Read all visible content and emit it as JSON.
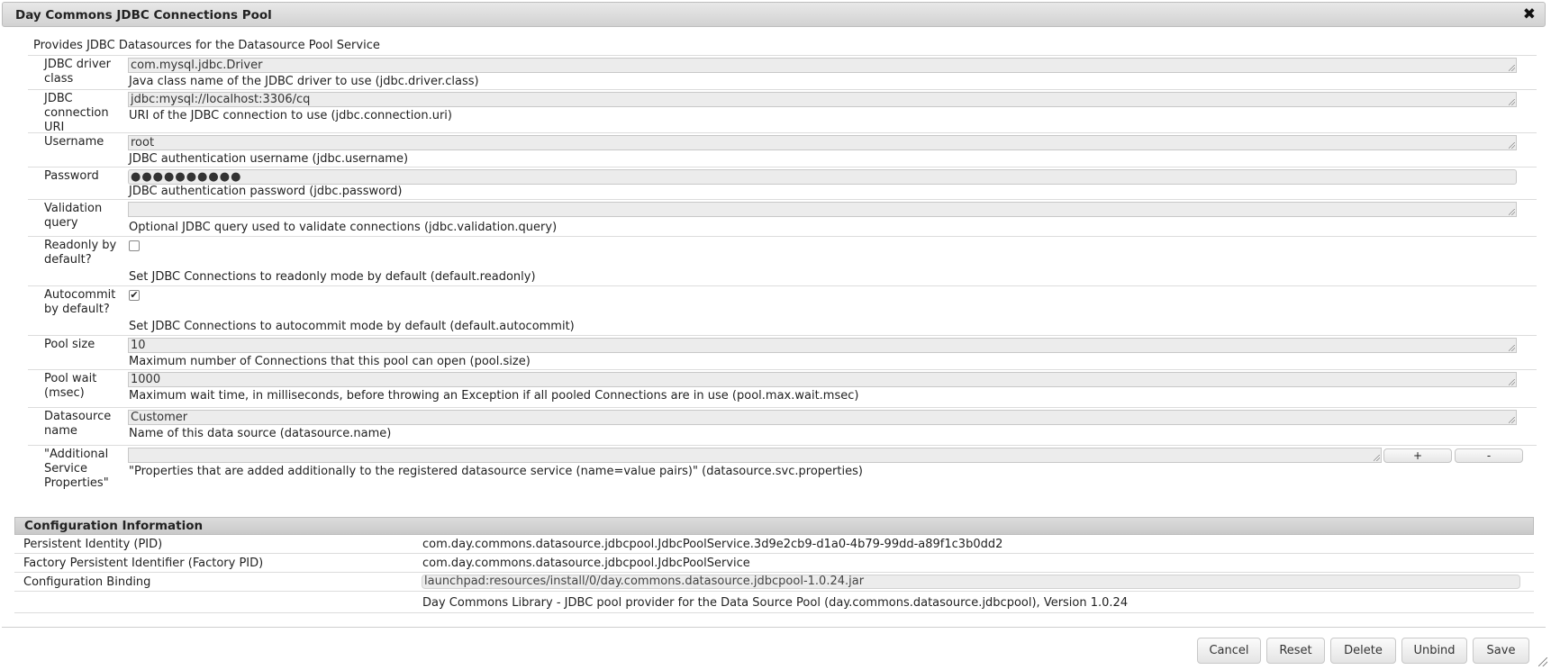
{
  "dialog": {
    "title": "Day Commons JDBC Connections Pool",
    "close_glyph": "✖",
    "description": "Provides JDBC Datasources for the Datasource Pool Service"
  },
  "fields": [
    {
      "label": "JDBC driver class",
      "value": "com.mysql.jdbc.Driver",
      "help": "Java class name of the JDBC driver to use (jdbc.driver.class)"
    },
    {
      "label": "JDBC connection URI",
      "value": "jdbc:mysql://localhost:3306/cq",
      "help": "URI of the JDBC connection to use (jdbc.connection.uri)"
    },
    {
      "label": "Username",
      "value": "root",
      "help": "JDBC authentication username (jdbc.username)"
    },
    {
      "label": "Password",
      "value": "●●●●●●●●●●",
      "help": "JDBC authentication password (jdbc.password)"
    },
    {
      "label": "Validation query",
      "value": "",
      "help": "Optional JDBC query used to validate connections (jdbc.validation.query)"
    },
    {
      "label": "Readonly by default?",
      "checked": false,
      "help": "Set JDBC Connections to readonly mode by default (default.readonly)"
    },
    {
      "label": "Autocommit by default?",
      "checked": true,
      "check_glyph": "✔",
      "help": "Set JDBC Connections to autocommit mode by default (default.autocommit)"
    },
    {
      "label": "Pool size",
      "value": "10",
      "help": "Maximum number of Connections that this pool can open (pool.size)"
    },
    {
      "label": "Pool wait (msec)",
      "value": "1000",
      "help": "Maximum wait time, in milliseconds, before throwing an Exception if all pooled Connections are in use (pool.max.wait.msec)"
    },
    {
      "label": "Datasource name",
      "value": "Customer",
      "help": "Name of this data source (datasource.name)"
    },
    {
      "label": "\"Additional Service Properties\"",
      "value": "",
      "help": "\"Properties that are added additionally to the registered datasource service (name=value pairs)\" (datasource.svc.properties)",
      "add_label": "+",
      "remove_label": "-"
    }
  ],
  "config_info": {
    "heading": "Configuration Information",
    "pid_label": "Persistent Identity (PID)",
    "pid_value": "com.day.commons.datasource.jdbcpool.JdbcPoolService.3d9e2cb9-d1a0-4b79-99dd-a89f1c3b0dd2",
    "factory_pid_label": "Factory Persistent Identifier (Factory PID)",
    "factory_pid_value": "com.day.commons.datasource.jdbcpool.JdbcPoolService",
    "binding_label": "Configuration Binding",
    "binding_value": "launchpad:resources/install/0/day.commons.datasource.jdbcpool-1.0.24.jar",
    "bundle_info": "Day Commons Library - JDBC pool provider for the Data Source Pool (day.commons.datasource.jdbcpool), Version 1.0.24"
  },
  "actions": {
    "cancel": "Cancel",
    "reset": "Reset",
    "delete": "Delete",
    "unbind": "Unbind",
    "save": "Save"
  }
}
